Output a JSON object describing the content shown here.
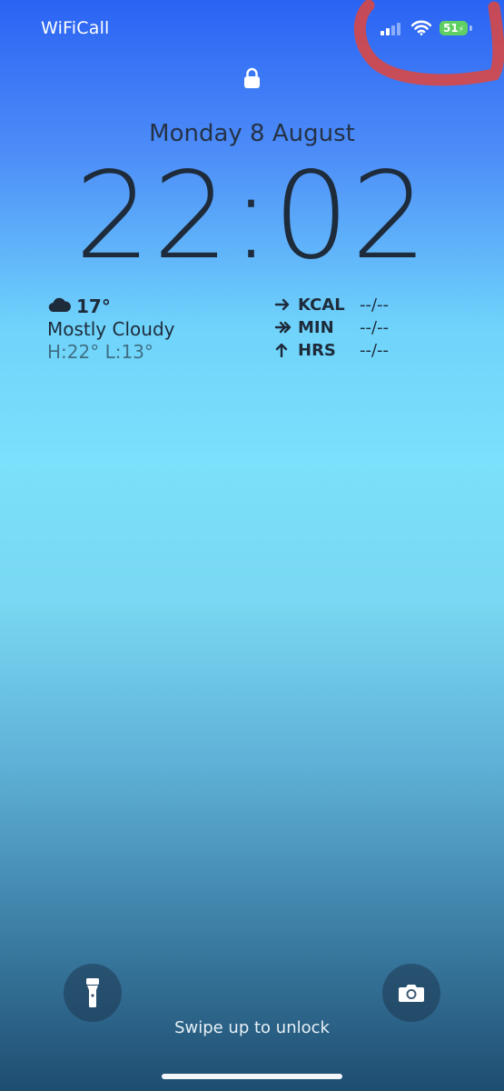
{
  "status_bar": {
    "carrier": "WiFiCall",
    "battery_level": "51",
    "signal_bars_active": 2,
    "signal_bars_total": 4,
    "charging": true
  },
  "lock_screen": {
    "date": "Monday 8 August",
    "time": "22:02",
    "swipe_hint": "Swipe up to unlock"
  },
  "weather_widget": {
    "temperature": "17°",
    "condition": "Mostly Cloudy",
    "high_low": "H:22° L:13°",
    "icon": "cloud-icon"
  },
  "activity_widget": {
    "rows": [
      {
        "icon": "arrow-right-icon",
        "label": "KCAL",
        "value": "--/--"
      },
      {
        "icon": "double-arrow-right-icon",
        "label": "MIN",
        "value": "--/--"
      },
      {
        "icon": "arrow-up-icon",
        "label": "HRS",
        "value": "--/--"
      }
    ]
  },
  "controls": {
    "left_icon": "flashlight-icon",
    "right_icon": "camera-icon"
  },
  "colors": {
    "battery_green": "#5fcf63",
    "annotation_red": "#e0453c",
    "text_dark": "#1e2b3b",
    "gradient_top": "#2a63f3",
    "gradient_bottom": "#1e4d70"
  }
}
